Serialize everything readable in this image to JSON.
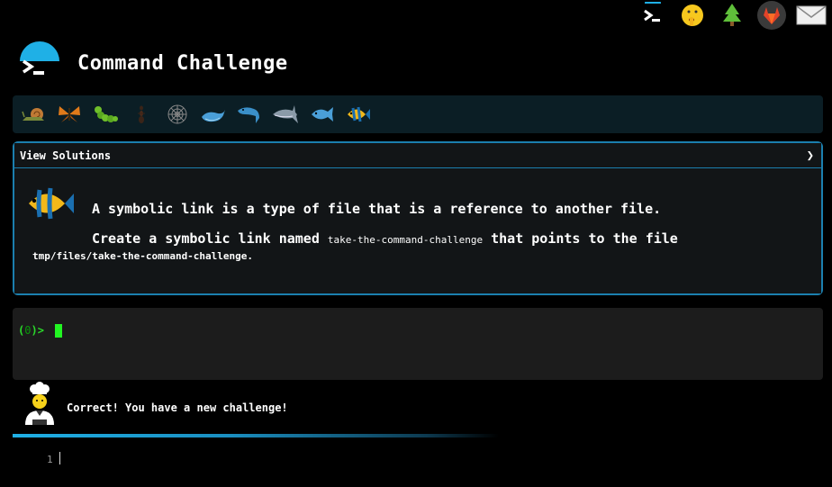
{
  "header": {
    "title": "Command Challenge",
    "icons": [
      "terminal-icon",
      "shushing-face-icon",
      "tree-icon",
      "gitlab-icon",
      "mail-icon"
    ]
  },
  "levels": [
    "snail-icon",
    "butterfly-icon",
    "caterpillar-icon",
    "ant-icon",
    "spider-web-icon",
    "whale-icon",
    "dolphin-icon",
    "shark-icon",
    "fish-icon",
    "tropical-fish-icon"
  ],
  "challenge": {
    "header_label": "View Solutions",
    "chevron": "❯",
    "line1": "A symbolic link is a type of file that is a reference to another file.",
    "line2_pre": "Create a symbolic link named",
    "line2_code": "take-the-command-challenge",
    "line2_post": "that points to the file",
    "line3_path": "tmp/files/take-the-command-challenge",
    "line3_end": "."
  },
  "terminal": {
    "prompt_open": "(",
    "prompt_num": "0",
    "prompt_close": ")>"
  },
  "status": {
    "message": "Correct! You have a new challenge!"
  },
  "editor": {
    "line_number": "1"
  },
  "colors": {
    "accent": "#1fb0e6",
    "prompt_green": "#2bd92b",
    "card_border": "#1b7fae"
  }
}
